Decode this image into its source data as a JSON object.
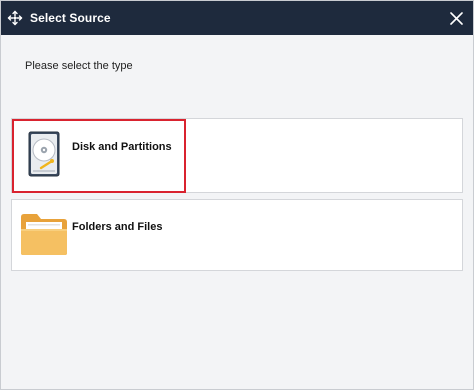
{
  "dialog": {
    "title": "Select Source",
    "title_icon": "select-source-icon",
    "close_icon": "close-icon"
  },
  "prompt": "Please select the type",
  "options": [
    {
      "label": "Disk and Partitions",
      "icon": "disk-icon",
      "highlighted": true,
      "highlight_color": "#d9232f"
    },
    {
      "label": "Folders and Files",
      "icon": "folder-icon",
      "highlighted": false
    }
  ],
  "colors": {
    "titlebar": "#1e2a3d",
    "background": "#f3f4f6",
    "highlight": "#d9232f"
  }
}
